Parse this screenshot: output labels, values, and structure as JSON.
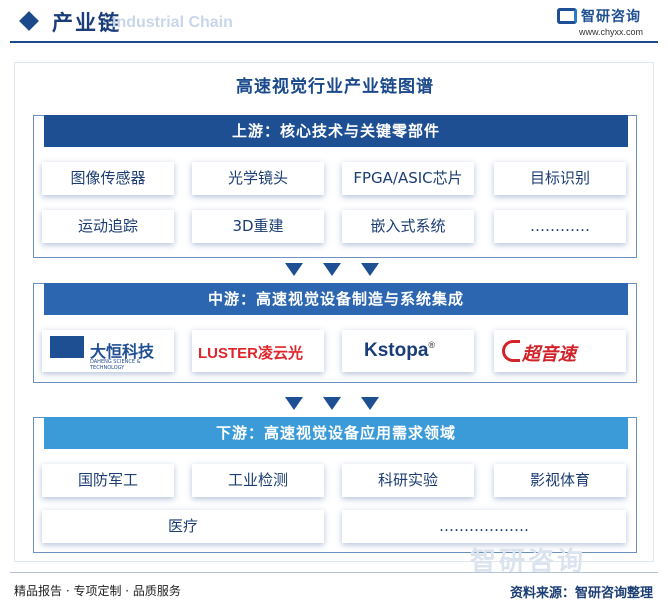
{
  "header": {
    "title": "产业链",
    "ghost_text": "Industrial Chain",
    "logo_name": "智研咨询",
    "logo_url": "www.chyxx.com"
  },
  "main_title": "高速视觉行业产业链图谱",
  "upstream": {
    "title": "上游：核心技术与关键零部件",
    "items": [
      "图像传感器",
      "光学镜头",
      "FPGA/ASIC芯片",
      "目标识别",
      "运动追踪",
      "3D重建",
      "嵌入式系统",
      "…………"
    ]
  },
  "midstream": {
    "title": "中游：高速视觉设备制造与系统集成",
    "companies": [
      {
        "name": "大恒科技",
        "sub": "DAHENG SCIENCE & TECHNOLOGY",
        "mark": "大恒科技"
      },
      {
        "name": "LUSTER凌云光"
      },
      {
        "name": "Kstopa",
        "sup": "®"
      },
      {
        "name": "超音速"
      }
    ]
  },
  "downstream": {
    "title": "下游：高速视觉设备应用需求领域",
    "items": [
      "国防军工",
      "工业检测",
      "科研实验",
      "影视体育",
      "医疗",
      "………………"
    ]
  },
  "footer": {
    "left": "精品报告 · 专项定制 · 品质服务",
    "source": "资料来源：智研咨询整理",
    "watermark": "智研咨询"
  },
  "colors": {
    "upstream_header": "#1f4f93",
    "midstream_header": "#2d66b0",
    "downstream_header": "#3b9bd9",
    "text": "#1b3d73"
  }
}
